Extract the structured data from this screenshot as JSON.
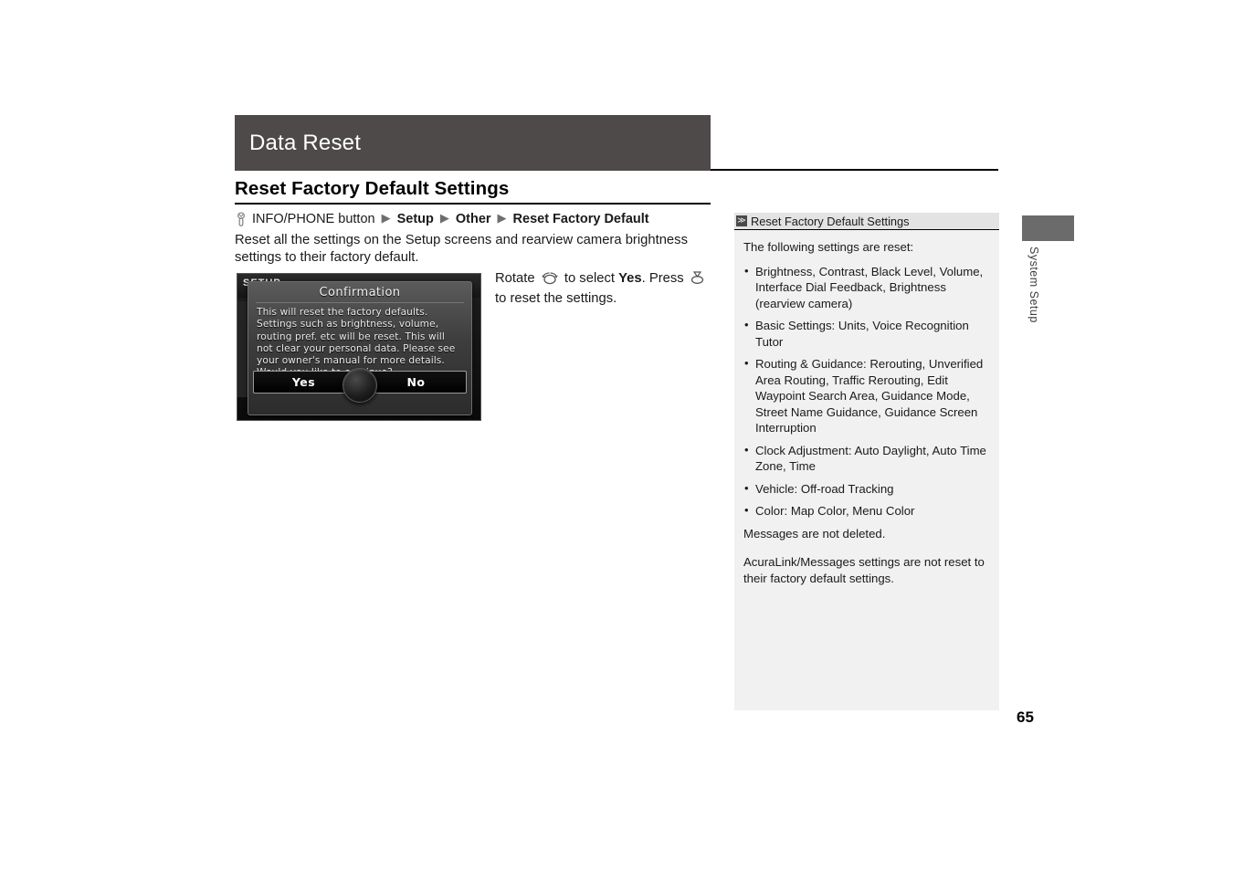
{
  "chapter": {
    "title": "Data Reset"
  },
  "section": {
    "title": "Reset Factory Default Settings"
  },
  "breadcrumb": {
    "icon": "info-phone-button-icon",
    "start_label": "INFO/PHONE button",
    "arrow": "▶",
    "steps": [
      "Setup",
      "Other",
      "Reset Factory Default"
    ]
  },
  "intro": {
    "text": "Reset all the settings on the Setup screens and rearview camera brightness settings to their factory default."
  },
  "device": {
    "screen_label": "SETUP",
    "dialog_title": "Confirmation",
    "dialog_body": "This will reset the factory defaults. Settings such as brightness, volume, routing pref. etc will be reset. This will not clear your personal data. Please see your owner's manual for more details. Would you like to continue?",
    "button_yes": "Yes",
    "button_no": "No",
    "knob": "interface-dial-knob"
  },
  "instruction": {
    "part1": "Rotate",
    "dial_icon": "rotate-dial-icon",
    "part2": "to select",
    "emphasis1": "Yes",
    "part3": ". Press",
    "press_icon": "press-dial-icon",
    "part4": "to reset the settings."
  },
  "sidebar": {
    "marker": "≫",
    "header": "Reset Factory Default Settings",
    "lead": "The following settings are reset:",
    "items": [
      "Brightness, Contrast, Black Level, Volume, Interface Dial Feedback, Brightness (rearview camera)",
      "Basic Settings: Units, Voice Recognition Tutor",
      "Routing & Guidance: Rerouting, Unverified Area Routing, Traffic Rerouting, Edit Waypoint Search Area, Guidance Mode, Street Name Guidance, Guidance Screen Interruption",
      "Clock Adjustment: Auto Daylight, Auto Time Zone, Time",
      "Vehicle: Off-road Tracking",
      "Color: Map Color, Menu Color"
    ],
    "note": "Messages are not deleted.",
    "note2": "AcuraLink/Messages settings are not reset to their factory default settings."
  },
  "edge": {
    "tab_label": "System Setup"
  },
  "footer": {
    "page_number": "65"
  },
  "colors": {
    "header_bar": "#4d4a49",
    "sidebar_bg": "#f1f1f1",
    "sidebar_header_bg": "#e3e3e3",
    "edge_tab": "#6b6b6b"
  }
}
